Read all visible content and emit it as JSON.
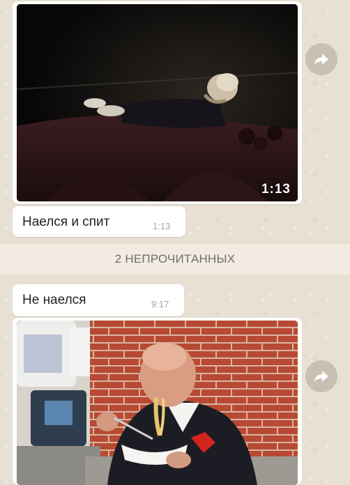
{
  "messages": [
    {
      "type": "video",
      "duration": "1:13"
    },
    {
      "type": "text",
      "text": "Наелся и спит",
      "time": "1:13"
    },
    {
      "type": "text",
      "text": "Не наелся",
      "time": "9:17"
    },
    {
      "type": "image"
    }
  ],
  "unread_divider": {
    "label": "2 НЕПРОЧИТАННЫХ"
  },
  "icons": {
    "forward": "forward-arrow-icon"
  },
  "colors": {
    "wallpaper": "#e8e0d3",
    "bubble": "#ffffff",
    "forward_button": "#c9c0b4",
    "divider": "#f3ebe2"
  }
}
